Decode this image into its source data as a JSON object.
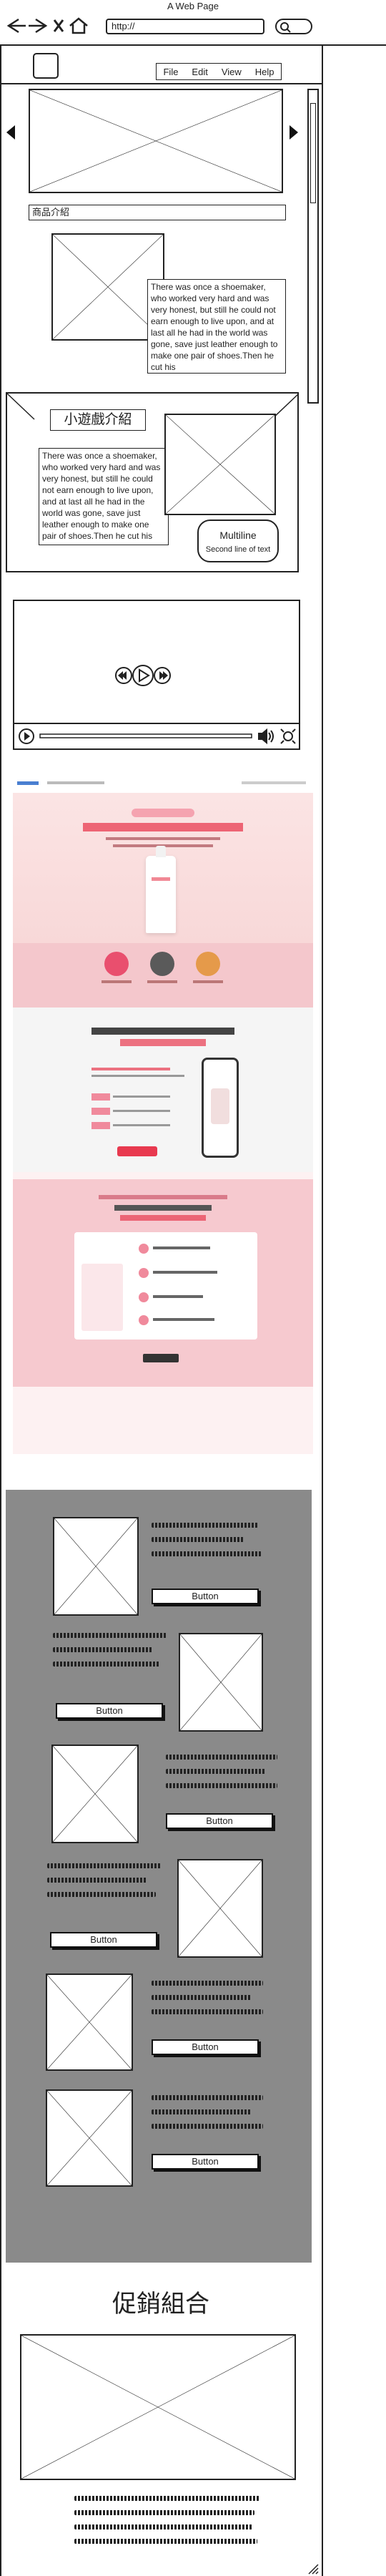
{
  "browser": {
    "title": "A Web Page",
    "url": "http://",
    "icons": [
      "back-arrow-icon",
      "forward-arrow-icon",
      "close-icon",
      "home-icon",
      "search-icon"
    ]
  },
  "menu": {
    "items": [
      "File",
      "Edit",
      "View",
      "Help"
    ]
  },
  "product_intro": {
    "label": "商品介紹",
    "story": "There was once a shoemaker, who worked very hard and was very honest, but still he could not earn enough to live upon, and at last all he had in the world was gone, save just leather enough to make one pair of shoes.Then he cut his"
  },
  "game_intro": {
    "label": "小遊戲介紹",
    "story": "There was once a shoemaker, who worked very hard and was very honest, but still he could not earn enough to live upon, and at last all he had in the world was gone, save just leather enough to make one pair of shoes.Then he cut his",
    "bubble_title": "Multiline",
    "bubble_sub": "Second line of text"
  },
  "product_cards": {
    "button_label": "Button"
  },
  "promo": {
    "title": "促銷組合"
  },
  "colors": {
    "gray_panel": "#8a8a8a",
    "pink": "#f6c9cf",
    "accent": "#e8394f"
  }
}
